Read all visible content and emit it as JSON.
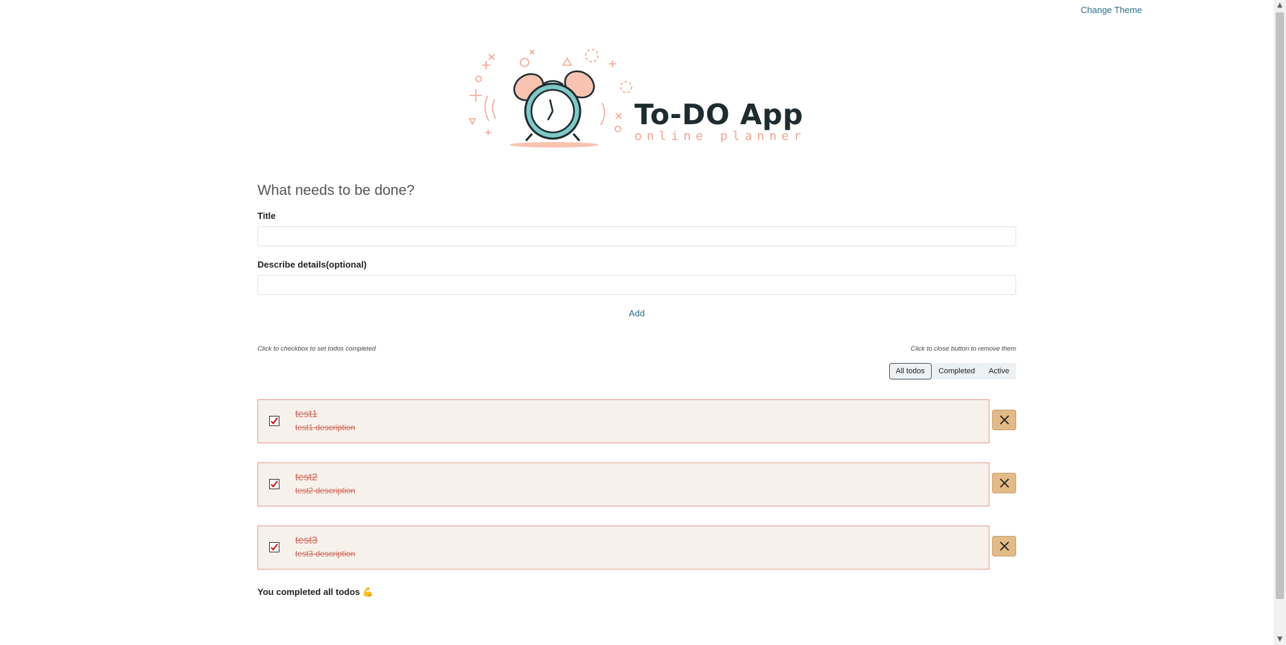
{
  "header": {
    "change_theme_label": "Change Theme"
  },
  "logo": {
    "title": "To-DO App",
    "subtitle": "online planner"
  },
  "form": {
    "heading": "What needs to be done?",
    "title_label": "Title",
    "title_value": "",
    "details_label": "Describe details(optional)",
    "details_value": "",
    "add_label": "Add"
  },
  "hints": {
    "left": "Click to checkbox to set todos completed",
    "right": "Click to close button to remove them"
  },
  "filters": [
    {
      "label": "All todos",
      "active": true
    },
    {
      "label": "Completed",
      "active": false
    },
    {
      "label": "Active",
      "active": false
    }
  ],
  "todos": [
    {
      "title": "test1",
      "description": "test1 description",
      "completed": true
    },
    {
      "title": "test2",
      "description": "test2 description",
      "completed": true
    },
    {
      "title": "test3",
      "description": "test3 description",
      "completed": true
    }
  ],
  "footer": {
    "message": "You completed all todos",
    "emoji": "💪"
  },
  "colors": {
    "accent_link": "#2a6f8a",
    "todo_background": "#f7f1ec",
    "todo_border": "#e29a8f",
    "completed_text": "#d06a5a",
    "remove_button": "#e3bb87",
    "check_mark": "#d11a1a"
  },
  "icons": {
    "logo": "alarm-clock-logo",
    "checkbox": "checkmark-icon",
    "remove": "close-icon"
  }
}
